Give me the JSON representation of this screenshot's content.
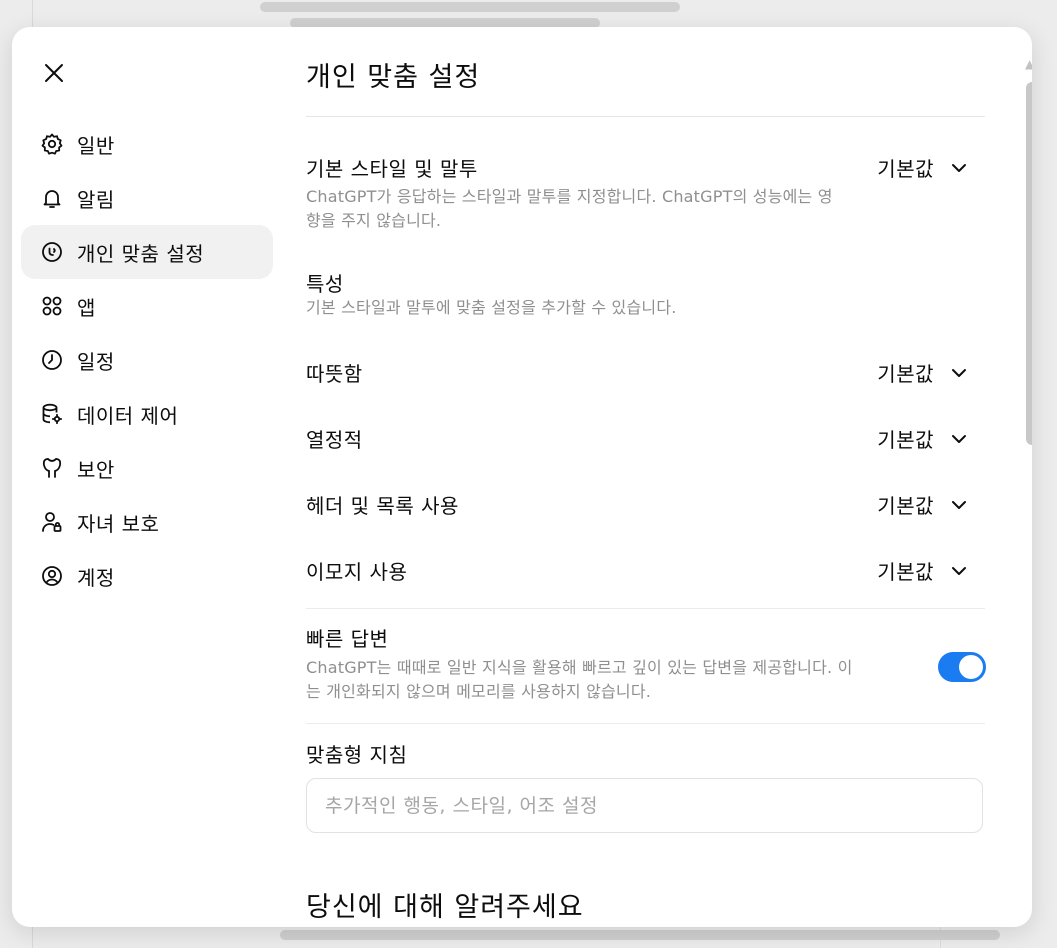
{
  "modal": {
    "title": "개인 맞춤 설정",
    "close_label": "close"
  },
  "nav": {
    "items": [
      {
        "label": "일반",
        "icon": "gear-icon"
      },
      {
        "label": "알림",
        "icon": "bell-icon"
      },
      {
        "label": "개인 맞춤 설정",
        "icon": "personalization-icon",
        "active": true
      },
      {
        "label": "앱",
        "icon": "apps-grid-icon"
      },
      {
        "label": "일정",
        "icon": "clock-icon"
      },
      {
        "label": "데이터 제어",
        "icon": "database-gear-icon"
      },
      {
        "label": "보안",
        "icon": "shield-icon"
      },
      {
        "label": "자녀 보호",
        "icon": "parent-user-icon"
      },
      {
        "label": "계정",
        "icon": "account-icon"
      }
    ]
  },
  "settings": {
    "base_style": {
      "label": "기본 스타일 및 말투",
      "description": "ChatGPT가 응답하는 스타일과 말투를 지정합니다. ChatGPT의 성능에는 영향을 주지 않습니다.",
      "value": "기본값"
    },
    "traits": {
      "label": "특성",
      "description": "기본 스타일과 말투에 맞춤 설정을 추가할 수 있습니다."
    },
    "warmth": {
      "label": "따뜻함",
      "value": "기본값"
    },
    "enthusiasm": {
      "label": "열정적",
      "value": "기본값"
    },
    "headers_lists": {
      "label": "헤더 및 목록 사용",
      "value": "기본값"
    },
    "emoji": {
      "label": "이모지 사용",
      "value": "기본값"
    },
    "quick_answers": {
      "label": "빠른 답변",
      "description": "ChatGPT는 때때로 일반 지식을 활용해 빠르고 깊이 있는 답변을 제공합니다. 이는 개인화되지 않으며 메모리를 사용하지 않습니다.",
      "enabled": true
    },
    "custom_instructions": {
      "label": "맞춤형 지침",
      "placeholder": "추가적인 행동, 스타일, 어조 설정",
      "value": ""
    },
    "about_you": {
      "title": "당신에 대해 알려주세요"
    }
  },
  "colors": {
    "accent": "#1a7cf0",
    "active_nav_bg": "#f1f1f1",
    "muted_text": "#8f8f8f"
  }
}
